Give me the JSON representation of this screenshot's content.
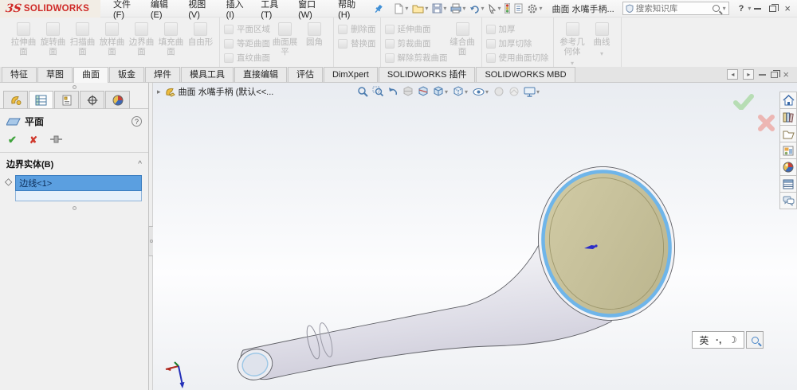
{
  "titlebar": {
    "logo_mark": "3S",
    "logo_text": "SOLIDWORKS",
    "menus": [
      "文件(F)",
      "编辑(E)",
      "视图(V)",
      "插入(I)",
      "工具(T)",
      "窗口(W)",
      "帮助(H)"
    ],
    "doc_title": "曲面 水嘴手柄...",
    "search_placeholder": "搜索知识库",
    "help_label": "?"
  },
  "ribbon": {
    "group1": [
      "拉伸曲面",
      "旋转曲面",
      "扫描曲面",
      "放样曲面",
      "边界曲面",
      "填充曲面",
      "自由形"
    ],
    "group2_small": [
      "平面区域",
      "等距曲面",
      "直纹曲面"
    ],
    "group2_large": [
      "曲面展平",
      "圆角"
    ],
    "group3_small": [
      "删除面",
      "替换面"
    ],
    "group4_small": [
      "延伸曲面",
      "剪裁曲面",
      "解除剪裁曲面"
    ],
    "group4_large": [
      "缝合曲面"
    ],
    "group5_small": [
      "加厚",
      "加厚切除",
      "使用曲面切除"
    ],
    "group6_large": [
      "参考几何体",
      "曲线"
    ]
  },
  "tabs": [
    "特征",
    "草图",
    "曲面",
    "钣金",
    "焊件",
    "模具工具",
    "直接编辑",
    "评估",
    "DimXpert",
    "SOLIDWORKS 插件",
    "SOLIDWORKS MBD"
  ],
  "panel": {
    "title": "平面",
    "help": "?",
    "section_title": "边界实体(B)",
    "selection": "边线<1>"
  },
  "viewport": {
    "breadcrumb": "曲面 水嘴手柄 (默认<<...",
    "ime_lang": "英",
    "ime_punct": "·,"
  },
  "glyphs": {
    "caret": "▾",
    "breadcrumb_arrow": "▸",
    "tab_left": "◂",
    "tab_right": "▸",
    "close": "×",
    "check": "✔",
    "cross": "✘",
    "chevron_up": "^",
    "diamond": "◇",
    "moon": "☽"
  },
  "colors": {
    "accent_red": "#cf2a27",
    "selection_blue": "#5b9fe0",
    "edge_highlight_blue": "#6fb5e9",
    "face_tan": "#c6c09a"
  }
}
